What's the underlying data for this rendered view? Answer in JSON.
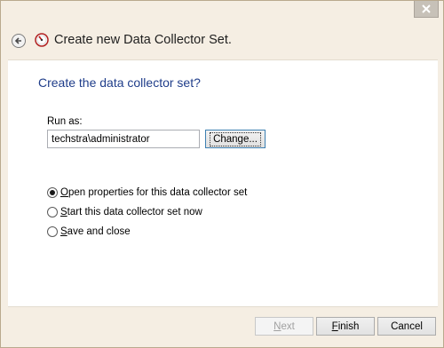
{
  "window": {
    "title": "Create new Data Collector Set."
  },
  "page": {
    "heading": "Create the data collector set?",
    "run_as_label": "Run as:",
    "run_as_value": "techstra\\administrator",
    "change_button": "Change..."
  },
  "options": [
    {
      "prefix": "",
      "accel": "O",
      "rest": "pen properties for this data collector set",
      "selected": true
    },
    {
      "prefix": "",
      "accel": "S",
      "rest": "tart this data collector set now",
      "selected": false
    },
    {
      "prefix": "",
      "accel": "S",
      "rest": "ave and close",
      "selected": false
    }
  ],
  "buttons": {
    "next": {
      "accel": "N",
      "rest": "ext",
      "enabled": false
    },
    "finish": {
      "accel": "F",
      "rest": "inish",
      "enabled": true
    },
    "cancel": {
      "label": "Cancel",
      "enabled": true
    }
  },
  "colors": {
    "heading": "#1f3d8a",
    "frame": "#f5eee3",
    "accent_border": "#3c7fb1"
  },
  "icons": {
    "close": "close-icon",
    "back": "back-arrow-icon",
    "app": "performance-monitor-icon"
  }
}
